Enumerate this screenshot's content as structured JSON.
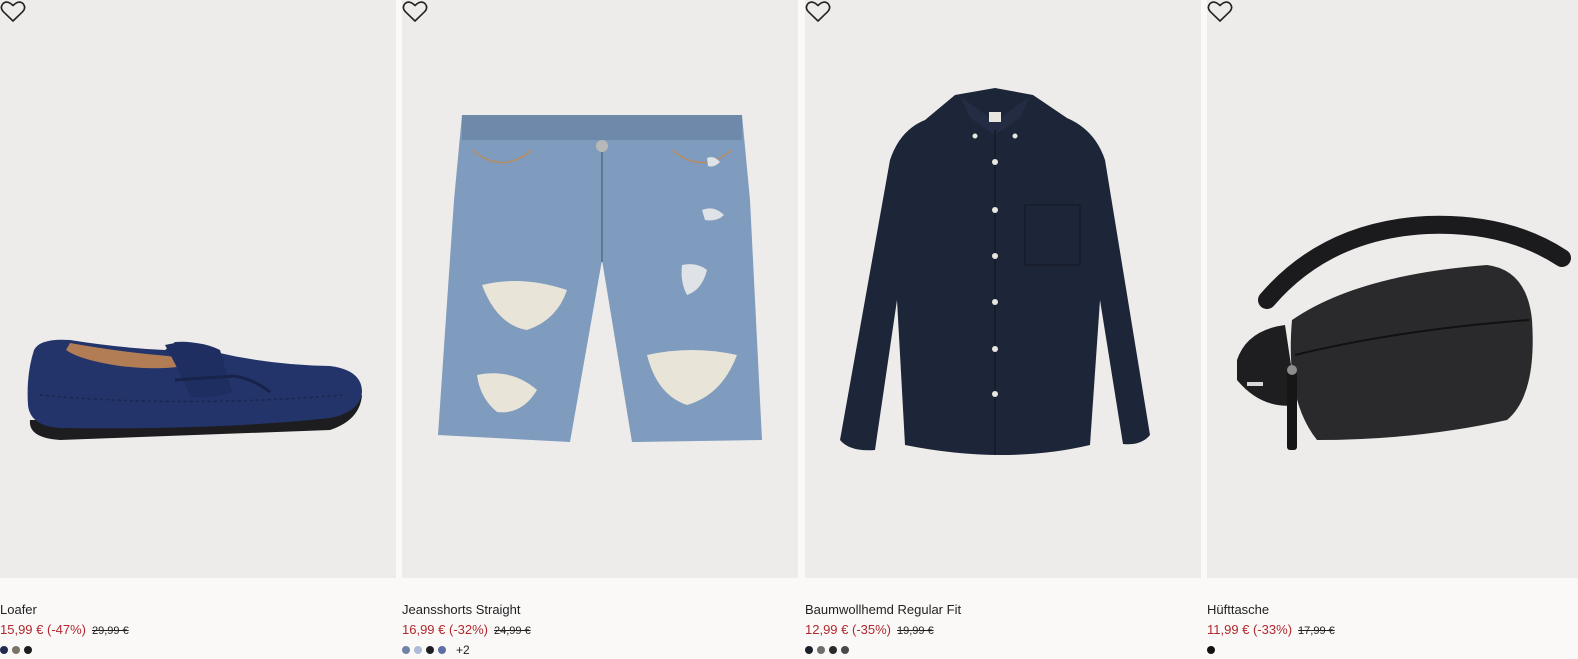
{
  "products": [
    {
      "name": "Loafer",
      "sale_price": "15,99 € (-47%)",
      "old_price": "29,99 €",
      "swatches": [
        "#1f2b4f",
        "#7a7366",
        "#1c1c1c"
      ],
      "more": ""
    },
    {
      "name": "Jeansshorts Straight",
      "sale_price": "16,99 € (-32%)",
      "old_price": "24,99 €",
      "swatches": [
        "#6f82a8",
        "#aebbd6",
        "#1e1e22",
        "#5d6ea3"
      ],
      "more": "+2"
    },
    {
      "name": "Baumwollhemd Regular Fit",
      "sale_price": "12,99 € (-35%)",
      "old_price": "19,99 €",
      "swatches": [
        "#1a1f2c",
        "#6d6d6d",
        "#2a2a2a",
        "#4a4a4a"
      ],
      "more": ""
    },
    {
      "name": "Hüfttasche",
      "sale_price": "11,99 € (-33%)",
      "old_price": "17,99 €",
      "swatches": [
        "#111111"
      ],
      "more": ""
    }
  ],
  "icons": {
    "favorite": "heart-icon"
  },
  "colors": {
    "sale": "#b1282d",
    "image_bg": "#edecea",
    "page_bg": "#faf9f8"
  }
}
